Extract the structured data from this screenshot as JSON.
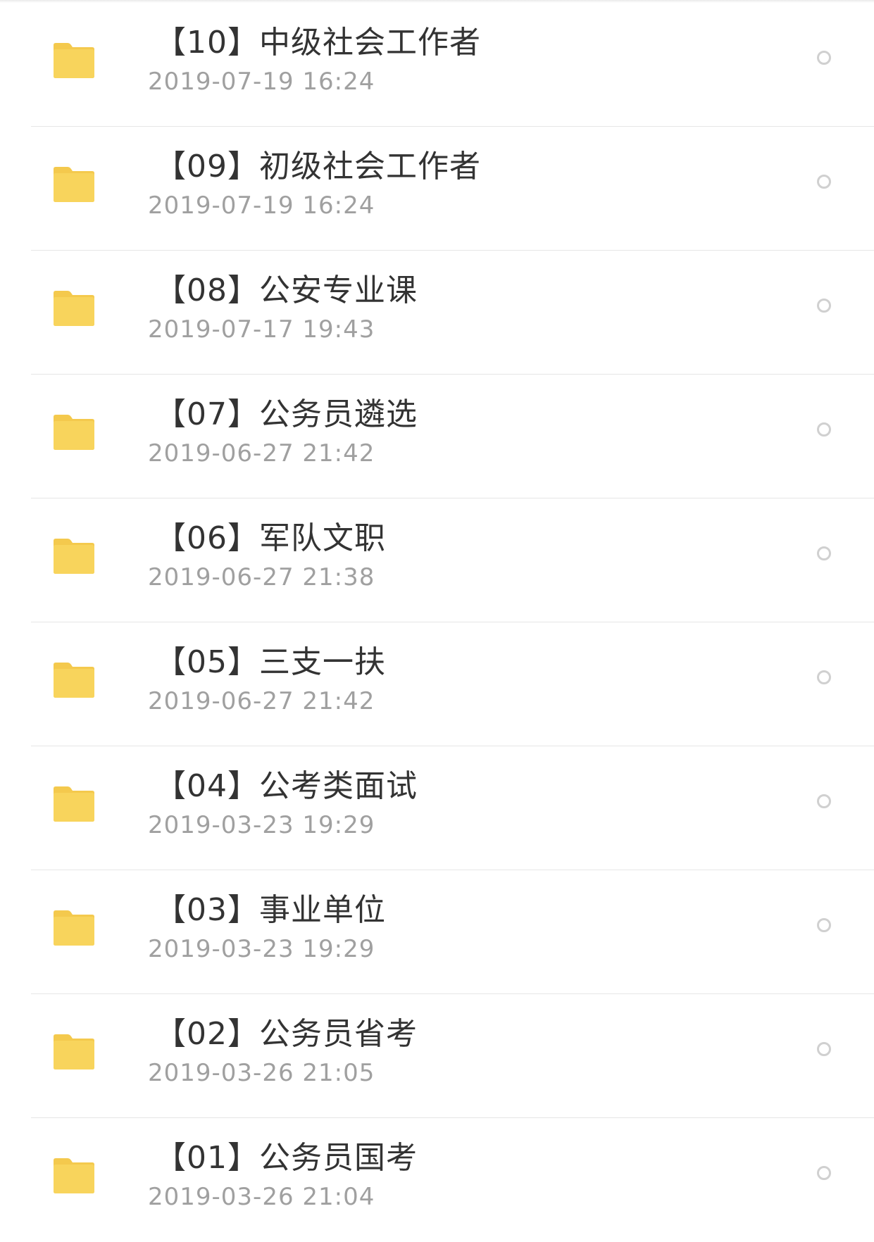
{
  "accent_color": "#f7d35a",
  "files": [
    {
      "title": "【10】中级社会工作者",
      "date": "2019-07-19 16:24",
      "icon": "folder-icon"
    },
    {
      "title": "【09】初级社会工作者",
      "date": "2019-07-19 16:24",
      "icon": "folder-icon"
    },
    {
      "title": "【08】公安专业课",
      "date": "2019-07-17 19:43",
      "icon": "folder-icon"
    },
    {
      "title": "【07】公务员遴选",
      "date": "2019-06-27 21:42",
      "icon": "folder-icon"
    },
    {
      "title": "【06】军队文职",
      "date": "2019-06-27 21:38",
      "icon": "folder-icon"
    },
    {
      "title": "【05】三支一扶",
      "date": "2019-06-27 21:42",
      "icon": "folder-icon"
    },
    {
      "title": "【04】公考类面试",
      "date": "2019-03-23 19:29",
      "icon": "folder-icon"
    },
    {
      "title": "【03】事业单位",
      "date": "2019-03-23 19:29",
      "icon": "folder-icon"
    },
    {
      "title": "【02】公务员省考",
      "date": "2019-03-26 21:05",
      "icon": "folder-icon"
    },
    {
      "title": "【01】公务员国考",
      "date": "2019-03-26 21:04",
      "icon": "folder-icon"
    }
  ]
}
